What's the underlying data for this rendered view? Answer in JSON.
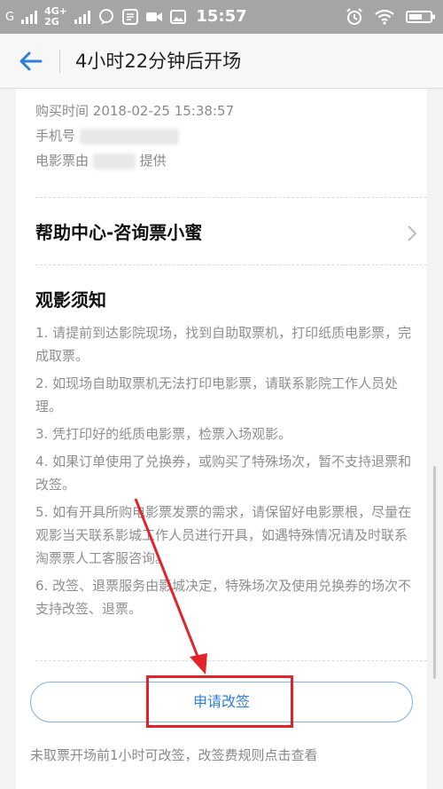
{
  "status_bar": {
    "carrier_left": "G",
    "net_top": "4G+",
    "net_bottom": "2G",
    "time": "15:57"
  },
  "header": {
    "title": "4小时22分钟后开场"
  },
  "order_info": {
    "purchase_time_label": "购买时间",
    "purchase_time_value": "2018-02-25 15:38:57",
    "phone_label": "手机号",
    "provider_prefix": "电影票由",
    "provider_suffix": "提供"
  },
  "help": {
    "label": "帮助中心-咨询票小蜜"
  },
  "notice": {
    "title": "观影须知",
    "rules": [
      "1. 请提前到达影院现场，找到自助取票机，打印纸质电影票，完成取票。",
      "2. 如现场自助取票机无法打印电影票，请联系影院工作人员处理。",
      "3. 凭打印好的纸质电影票，检票入场观影。",
      "4. 如果订单使用了兑换券，或购买了特殊场次，暂不支持退票和改签。",
      "5. 如有开具所购电影票发票的需求，请保留好电影票根，尽量在观影当天联系影城工作人员进行开具，如遇特殊情况请及时联系淘票票人工客服咨询。",
      "6. 改签、退票服务由影城决定，特殊场次及使用兑换券的场次不支持改签、退票。"
    ]
  },
  "actions": {
    "apply_change_label": "申请改签",
    "footnote": "未取票开场前1小时可改签，改签费规则点击查看"
  },
  "colors": {
    "accent_blue": "#2f7fd8",
    "annotation_red": "#e2232a"
  }
}
